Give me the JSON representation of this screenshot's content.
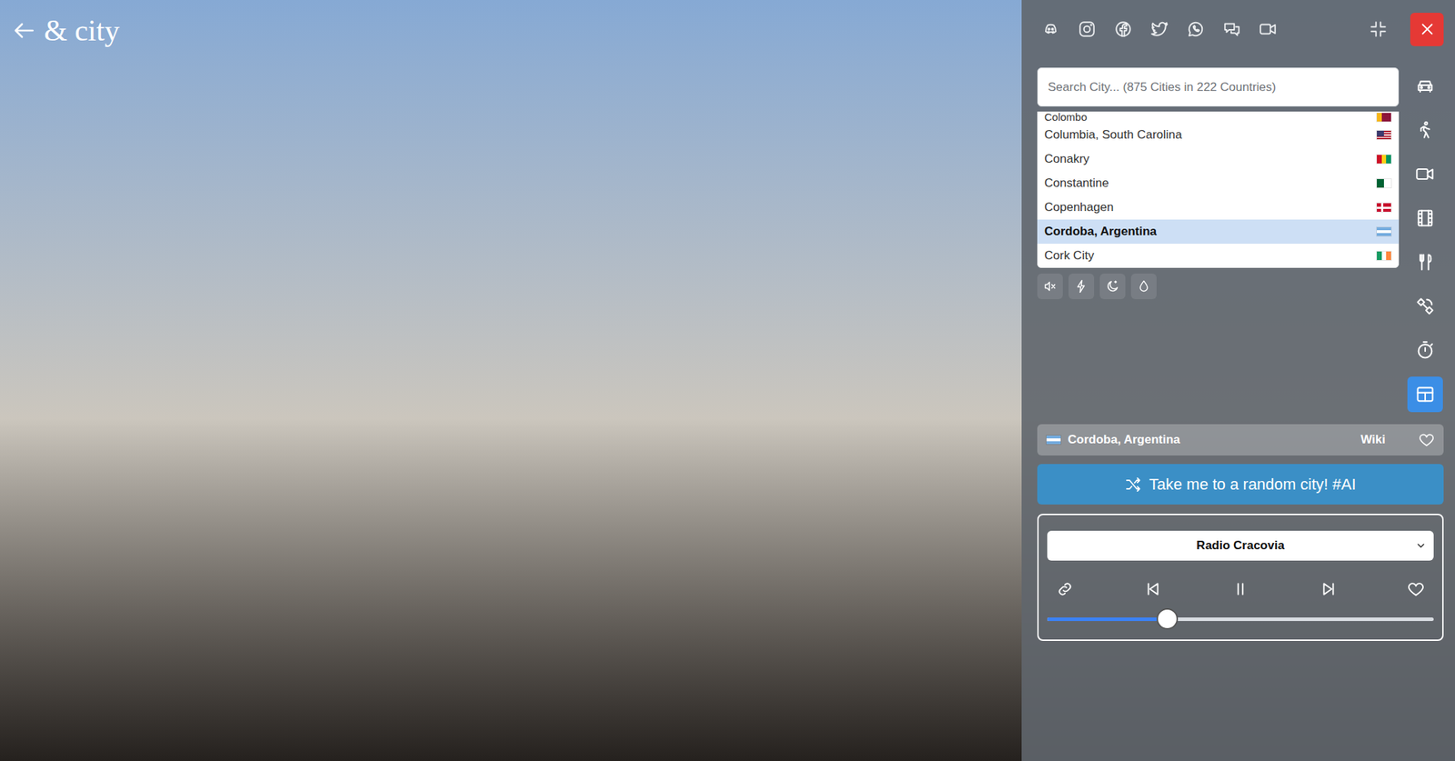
{
  "header": {
    "logo": "& city"
  },
  "search": {
    "placeholder": "Search City... (875 Cities in 222 Countries)"
  },
  "city_list": [
    {
      "name": "Colombo",
      "selected": false,
      "flag": {
        "kind": "vertical",
        "colors": [
          "#f7b718",
          "#8d153a",
          "#8d153a"
        ]
      }
    },
    {
      "name": "Columbia, South Carolina",
      "selected": false,
      "flag": {
        "kind": "us",
        "colors": [
          "#b22234",
          "#ffffff",
          "#3c3b6e"
        ]
      }
    },
    {
      "name": "Conakry",
      "selected": false,
      "flag": {
        "kind": "vertical",
        "colors": [
          "#ce1126",
          "#fcd116",
          "#009460"
        ]
      }
    },
    {
      "name": "Constantine",
      "selected": false,
      "flag": {
        "kind": "vertical",
        "colors": [
          "#006233",
          "#ffffff"
        ]
      }
    },
    {
      "name": "Copenhagen",
      "selected": false,
      "flag": {
        "kind": "cross",
        "colors": [
          "#c8102e",
          "#ffffff"
        ]
      }
    },
    {
      "name": "Cordoba, Argentina",
      "selected": true,
      "flag": {
        "kind": "horizontal",
        "colors": [
          "#74acdf",
          "#ffffff",
          "#74acdf"
        ]
      }
    },
    {
      "name": "Cork City",
      "selected": false,
      "flag": {
        "kind": "vertical",
        "colors": [
          "#169b62",
          "#ffffff",
          "#ff883e"
        ]
      }
    }
  ],
  "tools": [
    {
      "selected": false
    },
    {
      "selected": false
    },
    {
      "selected": false
    },
    {
      "selected": false
    },
    {
      "selected": false
    },
    {
      "selected": false
    },
    {
      "selected": false
    },
    {
      "selected": true
    }
  ],
  "location": {
    "name": "Cordoba, Argentina",
    "link": "Wiki",
    "favorite": false,
    "flag": {
      "kind": "horizontal",
      "colors": [
        "#74acdf",
        "#ffffff",
        "#74acdf"
      ]
    }
  },
  "random_button": {
    "label": "Take me to a random city! #AI"
  },
  "radio": {
    "station": "Radio Cracovia",
    "playing": true,
    "favorite": false,
    "volume": {
      "level": 0.31
    }
  }
}
